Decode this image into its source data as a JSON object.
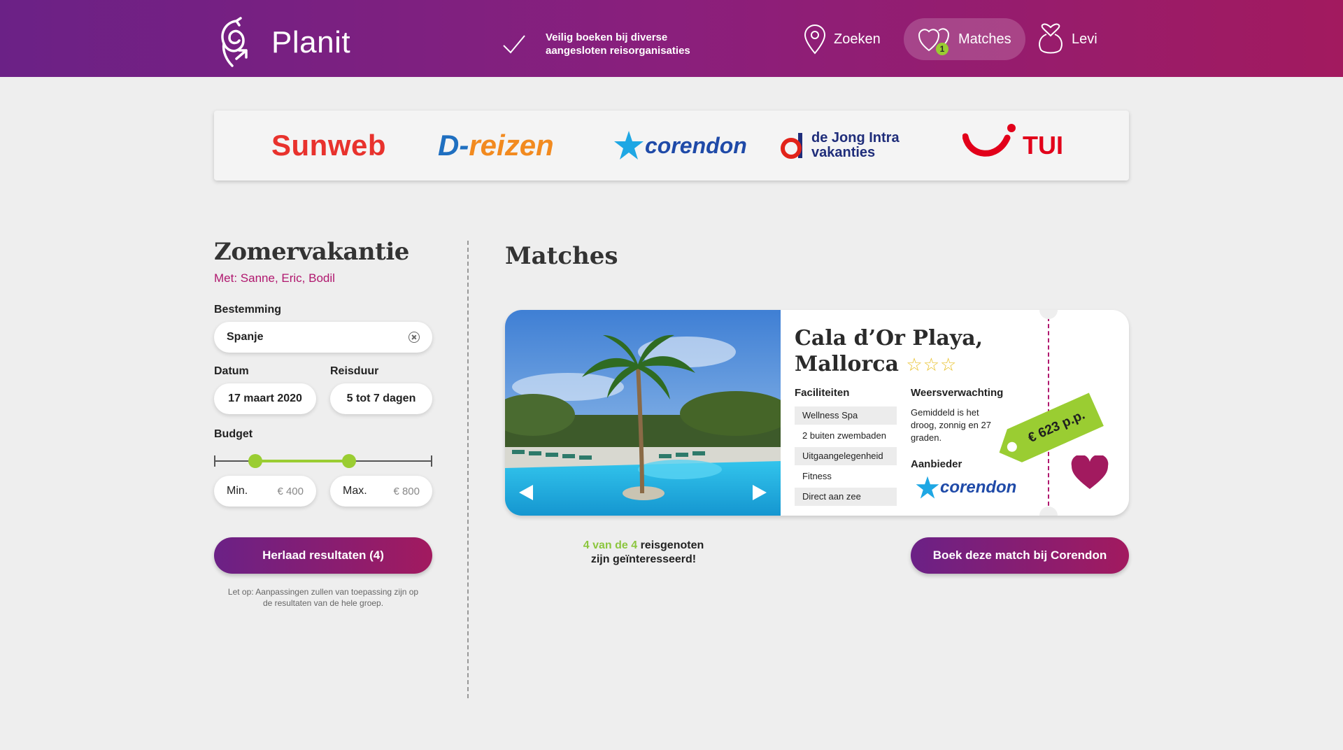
{
  "header": {
    "brand": "Planit",
    "secure_line1": "Veilig boeken bij diverse",
    "secure_line2": "aangesloten reisorganisaties",
    "nav": [
      {
        "label": "Zoeken",
        "icon": "location-pin-icon"
      },
      {
        "label": "Matches",
        "icon": "hearts-icon",
        "badge": "1",
        "active": true
      },
      {
        "label": "Levi",
        "icon": "user-heart-icon"
      }
    ]
  },
  "partners": [
    {
      "name": "Sunweb"
    },
    {
      "name": "D-",
      "name_tail": "reizen"
    },
    {
      "name": "corendon"
    },
    {
      "name_line1": "de Jong Intra",
      "name_line2": "vakanties"
    },
    {
      "name": "TUI"
    }
  ],
  "trip": {
    "title": "Zomervakantie",
    "with": "Met: Sanne, Eric, Bodil",
    "destination_label": "Bestemming",
    "destination_value": "Spanje",
    "date_label": "Datum",
    "date_value": "17 maart 2020",
    "duration_label": "Reisduur",
    "duration_value": "5 tot 7 dagen",
    "budget_label": "Budget",
    "budget_min_label": "Min.",
    "budget_min_value": "€ 400",
    "budget_max_label": "Max.",
    "budget_max_value": "€ 800",
    "slider_min_fraction": 0.19,
    "slider_max_fraction": 0.62,
    "reload_label": "Herlaad resultaten (4)",
    "note": "Let op: Aanpassingen zullen van toepassing zijn op de resultaten van de hele groep."
  },
  "matches": {
    "title": "Matches",
    "hotel_name_line1": "Cala d’Or Playa,",
    "hotel_name_line2": "Mallorca",
    "stars": "☆☆☆",
    "facilities_label": "Faciliteiten",
    "facilities": [
      "Wellness Spa",
      "2 buiten zwembaden",
      "Uitgaangelegenheid",
      "Fitness",
      "Direct aan zee"
    ],
    "weather_label": "Weersverwachting",
    "weather_text": "Gemiddeld is het droog, zonnig en 27 graden.",
    "provider_label": "Aanbieder",
    "provider_name": "corendon",
    "price": "€ 623 p.p.",
    "interest_count": "4 van de 4",
    "interest_rest1": "reisgenoten",
    "interest_line2": "zijn geïnteresseerd!",
    "book_label": "Boek deze match bij Corendon"
  },
  "colors": {
    "header_start": "#6b2186",
    "header_end": "#a21a5f",
    "accent_green": "#9acd32",
    "accent_magenta": "#b0176e"
  }
}
